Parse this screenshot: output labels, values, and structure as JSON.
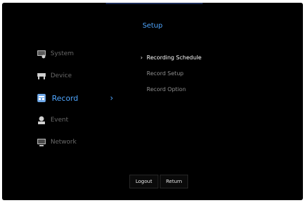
{
  "header": {
    "title": "Setup"
  },
  "sidebar": {
    "items": [
      {
        "label": "System",
        "icon": "system-icon",
        "active": false
      },
      {
        "label": "Device",
        "icon": "device-icon",
        "active": false
      },
      {
        "label": "Record",
        "icon": "record-icon",
        "active": true
      },
      {
        "label": "Event",
        "icon": "event-icon",
        "active": false
      },
      {
        "label": "Network",
        "icon": "network-icon",
        "active": false
      }
    ],
    "active_chevron": "›"
  },
  "submenu": {
    "items": [
      {
        "label": "Recording Schedule",
        "active": true,
        "marker": "›"
      },
      {
        "label": "Record Setup",
        "active": false,
        "marker": ""
      },
      {
        "label": "Record Option",
        "active": false,
        "marker": ""
      }
    ]
  },
  "footer": {
    "logout_label": "Logout",
    "return_label": "Return"
  },
  "colors": {
    "accent": "#4fa6ff",
    "background": "#000000",
    "inactive_text": "#6a6a6a"
  }
}
